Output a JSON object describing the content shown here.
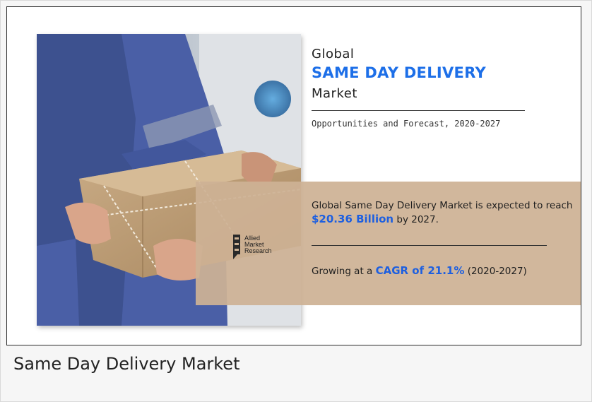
{
  "infographic": {
    "title_prefix": "Global",
    "title_main": "SAME DAY DELIVERY",
    "title_suffix": "Market",
    "subtitle": "Opportunities and Forecast, 2020-2027",
    "expect_text_before": "Global Same Day Delivery Market is expected to reach ",
    "expect_value": "$20.36 Billion",
    "expect_text_after": " by 2027.",
    "growth_text_before": "Growing at a ",
    "growth_value": "CAGR of 21.1%",
    "growth_text_after": " (2020-2027)",
    "logo_lines": [
      "Allied",
      "Market",
      "Research"
    ],
    "photo_icon": "delivery-package-photo",
    "colors": {
      "accent": "#1d6fe8",
      "panel": "#cdb294"
    }
  },
  "caption": "Same Day Delivery Market"
}
